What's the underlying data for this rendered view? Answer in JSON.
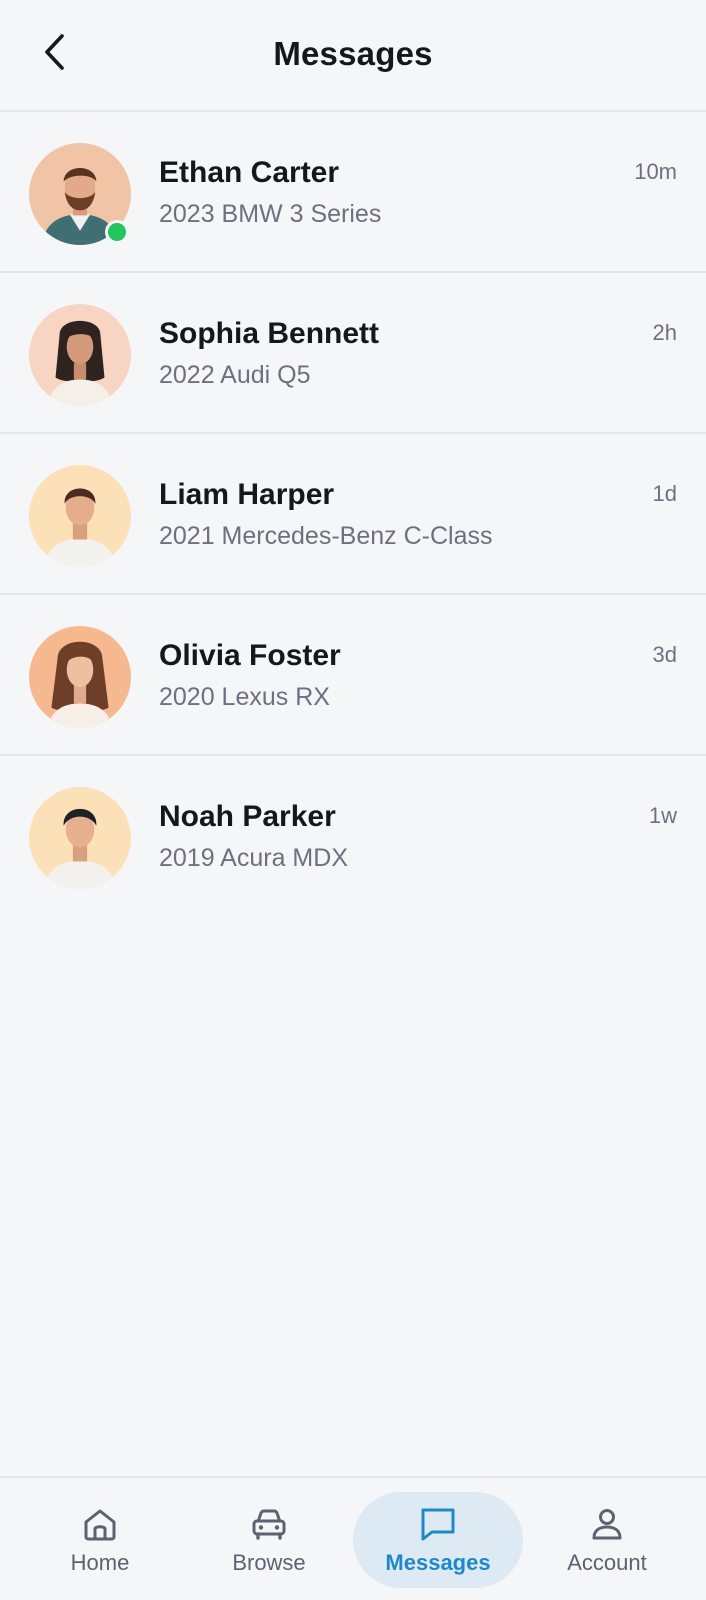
{
  "header": {
    "title": "Messages"
  },
  "conversations": [
    {
      "name": "Ethan Carter",
      "subtitle": "2023 BMW 3 Series",
      "time": "10m",
      "online": true
    },
    {
      "name": "Sophia Bennett",
      "subtitle": "2022 Audi Q5",
      "time": "2h",
      "online": false
    },
    {
      "name": "Liam Harper",
      "subtitle": "2021 Mercedes-Benz C-Class",
      "time": "1d",
      "online": false
    },
    {
      "name": "Olivia Foster",
      "subtitle": "2020 Lexus RX",
      "time": "3d",
      "online": false
    },
    {
      "name": "Noah Parker",
      "subtitle": "2019 Acura MDX",
      "time": "1w",
      "online": false
    }
  ],
  "bottom_nav": {
    "items": [
      {
        "label": "Home",
        "icon": "home-icon",
        "active": false
      },
      {
        "label": "Browse",
        "icon": "car-icon",
        "active": false
      },
      {
        "label": "Messages",
        "icon": "message-icon",
        "active": true
      },
      {
        "label": "Account",
        "icon": "user-icon",
        "active": false
      }
    ]
  },
  "colors": {
    "background": "#f5f6f8",
    "accent": "#1e88c9",
    "active_tab_bg": "#ddeaf3",
    "online": "#22c55e",
    "muted_text": "#6b7180"
  }
}
